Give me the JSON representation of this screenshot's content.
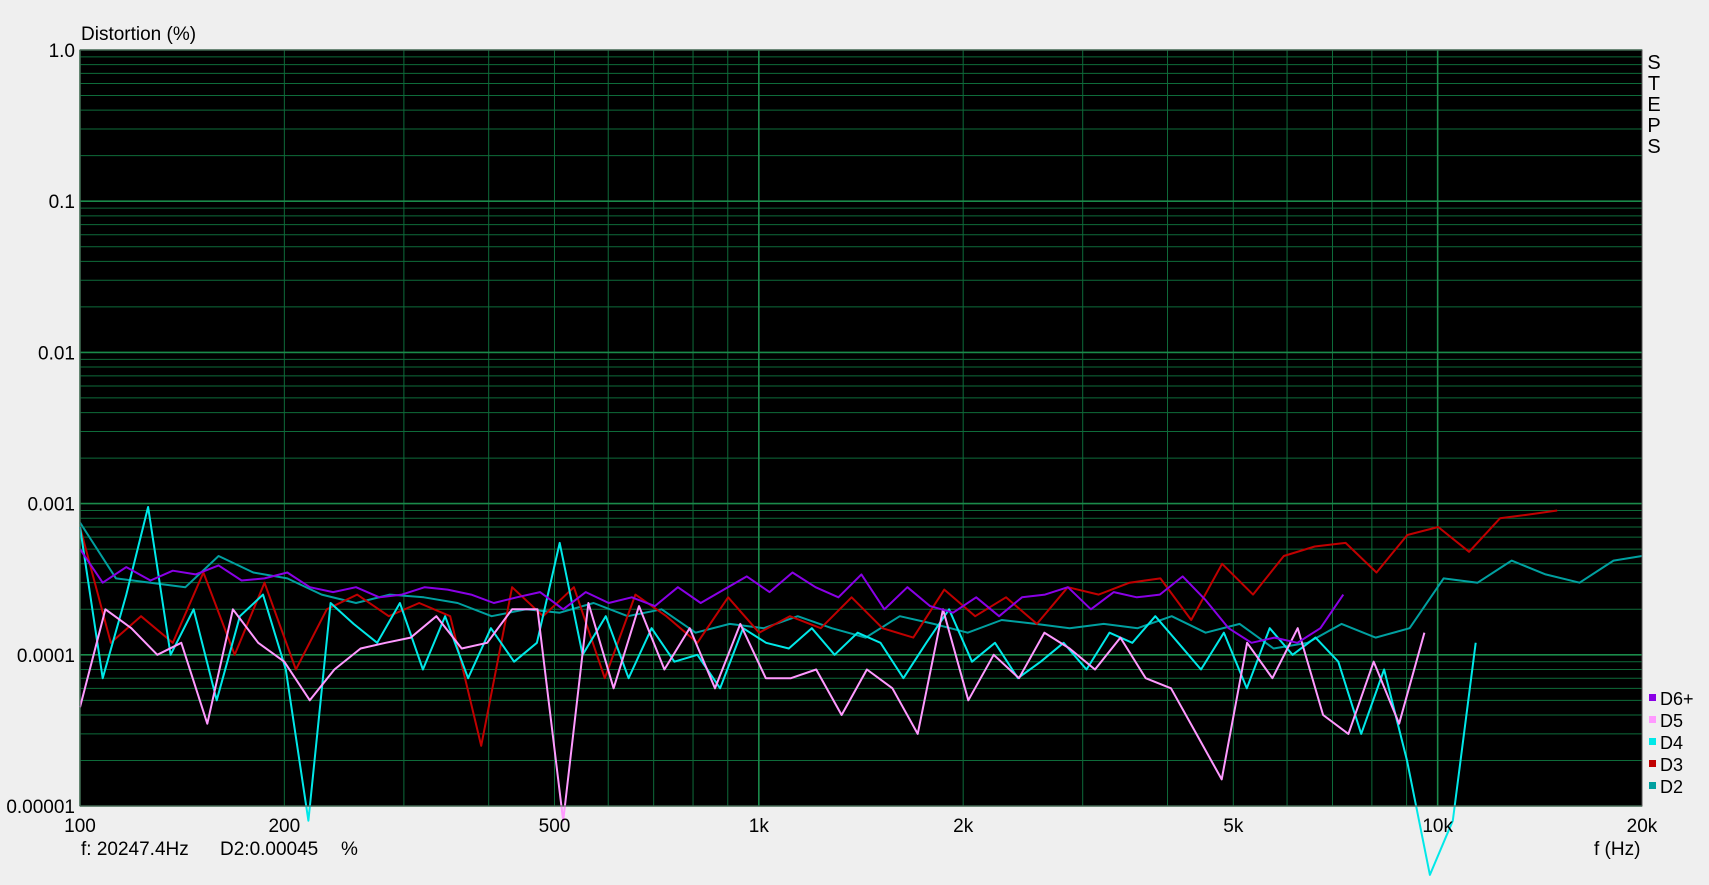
{
  "chart_data": {
    "type": "line",
    "ylabel": "Distortion (%)",
    "xlabel": "f (Hz)",
    "x_scale": "log",
    "y_scale": "log",
    "xlim": [
      100,
      20000
    ],
    "ylim": [
      1e-05,
      1.0
    ],
    "grid": true,
    "background": "#000000",
    "grid_color": "#0e6b3a",
    "legend_position": "bottom-right",
    "x_ticks": [
      {
        "value": 100,
        "label": "100"
      },
      {
        "value": 200,
        "label": "200"
      },
      {
        "value": 500,
        "label": "500"
      },
      {
        "value": 1000,
        "label": "1k"
      },
      {
        "value": 2000,
        "label": "2k"
      },
      {
        "value": 5000,
        "label": "5k"
      },
      {
        "value": 10000,
        "label": "10k"
      },
      {
        "value": 20000,
        "label": "20k"
      }
    ],
    "y_ticks": [
      {
        "value": 1.0,
        "label": "1.0"
      },
      {
        "value": 0.1,
        "label": "0.1"
      },
      {
        "value": 0.01,
        "label": "0.01"
      },
      {
        "value": 0.001,
        "label": "0.001"
      },
      {
        "value": 0.0001,
        "label": "0.0001"
      },
      {
        "value": 1e-05,
        "label": "0.00001"
      }
    ],
    "side_label": "STEPS",
    "cursor_readout": {
      "freq": "f:  20247.4Hz",
      "value": "D2:0.00045",
      "unit": "%"
    },
    "series": [
      {
        "name": "D2",
        "color": "#00a0a0",
        "x": [
          100,
          113,
          127,
          143,
          160,
          180,
          202,
          227,
          255,
          286,
          321,
          360,
          404,
          454,
          509,
          571,
          641,
          719,
          807,
          906,
          1017,
          1141,
          1281,
          1437,
          1613,
          1810,
          2031,
          2279,
          2558,
          2870,
          3221,
          3615,
          4057,
          4552,
          5109,
          5733,
          6434,
          7220,
          8103,
          9093,
          10204,
          11451,
          12850,
          14420,
          16183,
          18160,
          20000
        ],
        "y": [
          0.00075,
          0.00032,
          0.0003,
          0.00028,
          0.00045,
          0.00035,
          0.00032,
          0.00025,
          0.00022,
          0.00025,
          0.00024,
          0.00022,
          0.00018,
          0.0002,
          0.00019,
          0.00022,
          0.00018,
          0.0002,
          0.00014,
          0.00016,
          0.00015,
          0.00018,
          0.00015,
          0.00013,
          0.00018,
          0.00016,
          0.00014,
          0.00017,
          0.00016,
          0.00015,
          0.00016,
          0.00015,
          0.00018,
          0.00014,
          0.00016,
          0.00011,
          0.00012,
          0.00016,
          0.00013,
          0.00015,
          0.00032,
          0.0003,
          0.00042,
          0.00034,
          0.0003,
          0.00042,
          0.00045
        ]
      },
      {
        "name": "D3",
        "color": "#c00000",
        "x": [
          100,
          111,
          123,
          137,
          152,
          169,
          187,
          208,
          231,
          256,
          285,
          316,
          351,
          390,
          433,
          481,
          534,
          593,
          658,
          731,
          812,
          901,
          1001,
          1111,
          1234,
          1370,
          1521,
          1689,
          1876,
          2083,
          2313,
          2568,
          2852,
          3167,
          3516,
          3904,
          4335,
          4814,
          5345,
          5935,
          6590,
          7318,
          8126,
          9023,
          10019,
          11125,
          12353,
          13717,
          15000
        ],
        "y": [
          0.0007,
          0.00012,
          0.00018,
          0.00012,
          0.00035,
          0.0001,
          0.0003,
          8e-05,
          0.0002,
          0.00025,
          0.00018,
          0.00022,
          0.00018,
          2.5e-05,
          0.00028,
          0.00018,
          0.00028,
          7e-05,
          0.00025,
          0.00018,
          0.00012,
          0.00024,
          0.00014,
          0.00018,
          0.00015,
          0.00024,
          0.00015,
          0.00013,
          0.00027,
          0.00018,
          0.00024,
          0.00016,
          0.00028,
          0.00025,
          0.0003,
          0.00032,
          0.00017,
          0.0004,
          0.00025,
          0.00045,
          0.00052,
          0.00055,
          0.00035,
          0.00062,
          0.0007,
          0.00048,
          0.0008,
          0.00085,
          0.0009
        ]
      },
      {
        "name": "D4",
        "color": "#00e8e8",
        "x": [
          100,
          108,
          117,
          126,
          136,
          147,
          159,
          172,
          186,
          201,
          217,
          234,
          253,
          274,
          296,
          320,
          345,
          373,
          403,
          436,
          471,
          509,
          550,
          595,
          643,
          695,
          751,
          812,
          877,
          948,
          1025,
          1107,
          1197,
          1293,
          1398,
          1511,
          1633,
          1765,
          1907,
          2061,
          2228,
          2408,
          2602,
          2812,
          3039,
          3285,
          3550,
          3837,
          4147,
          4481,
          4843,
          5234,
          5657,
          6114,
          6607,
          7140,
          7717,
          8340,
          9013,
          9740,
          10526,
          11376
        ],
        "y": [
          0.0007,
          7e-05,
          0.00025,
          0.00095,
          0.0001,
          0.0002,
          5e-05,
          0.00018,
          0.00025,
          8e-05,
          8e-06,
          0.00022,
          0.00016,
          0.00012,
          0.00022,
          8e-05,
          0.00018,
          7e-05,
          0.00015,
          9e-05,
          0.00012,
          0.00055,
          0.0001,
          0.00018,
          7e-05,
          0.00015,
          9e-05,
          0.0001,
          6e-05,
          0.00015,
          0.00012,
          0.00011,
          0.00015,
          0.0001,
          0.00014,
          0.00012,
          7e-05,
          0.00012,
          0.0002,
          9e-05,
          0.00012,
          7e-05,
          9e-05,
          0.00012,
          8e-05,
          0.00014,
          0.00012,
          0.00018,
          0.00012,
          8e-05,
          0.00014,
          6e-05,
          0.00015,
          0.0001,
          0.00013,
          9e-05,
          3e-05,
          8e-05,
          2e-05,
          3.5e-06,
          8e-06,
          0.00012
        ]
      },
      {
        "name": "D5",
        "color": "#ff99ff",
        "x": [
          100,
          109,
          119,
          130,
          141,
          154,
          168,
          183,
          200,
          218,
          237,
          259,
          282,
          307,
          335,
          365,
          398,
          433,
          472,
          515,
          561,
          611,
          666,
          726,
          791,
          862,
          939,
          1024,
          1115,
          1215,
          1324,
          1443,
          1573,
          1714,
          1868,
          2035,
          2218,
          2417,
          2634,
          2870,
          3128,
          3409,
          3715,
          4048,
          4411,
          4807,
          5239,
          5709,
          6221,
          6780,
          7388,
          8051,
          8773,
          9561
        ],
        "y": [
          4.5e-05,
          0.0002,
          0.00015,
          0.0001,
          0.00012,
          3.5e-05,
          0.0002,
          0.00012,
          9e-05,
          5e-05,
          8e-05,
          0.00011,
          0.00012,
          0.00013,
          0.00018,
          0.00011,
          0.00012,
          0.0002,
          0.0002,
          8e-06,
          0.00022,
          6e-05,
          0.00021,
          8e-05,
          0.00015,
          6e-05,
          0.00016,
          7e-05,
          7e-05,
          8e-05,
          4e-05,
          8e-05,
          6e-05,
          3e-05,
          0.0002,
          5e-05,
          0.0001,
          7e-05,
          0.00014,
          0.00011,
          8e-05,
          0.00013,
          7e-05,
          6e-05,
          3e-05,
          1.5e-05,
          0.00012,
          7e-05,
          0.00015,
          4e-05,
          3e-05,
          9e-05,
          3.5e-05,
          0.00014
        ]
      },
      {
        "name": "D6+",
        "color": "#8a00e6",
        "x": [
          100,
          108,
          117,
          127,
          137,
          148,
          160,
          173,
          187,
          202,
          218,
          236,
          255,
          276,
          298,
          322,
          348,
          377,
          407,
          440,
          476,
          515,
          556,
          601,
          650,
          703,
          760,
          821,
          888,
          960,
          1037,
          1121,
          1212,
          1310,
          1416,
          1531,
          1655,
          1788,
          1933,
          2090,
          2259,
          2442,
          2640,
          2853,
          3084,
          3334,
          3604,
          3896,
          4211,
          4552,
          4920,
          5319,
          5749,
          6215,
          6718,
          7262
        ],
        "y": [
          0.0005,
          0.0003,
          0.00038,
          0.00031,
          0.00036,
          0.00034,
          0.00039,
          0.00031,
          0.00032,
          0.00035,
          0.00028,
          0.00026,
          0.00028,
          0.00024,
          0.00025,
          0.00028,
          0.00027,
          0.00025,
          0.00022,
          0.00024,
          0.00026,
          0.0002,
          0.00026,
          0.00022,
          0.00024,
          0.00021,
          0.00028,
          0.00022,
          0.00027,
          0.00033,
          0.00026,
          0.00035,
          0.00028,
          0.00024,
          0.00034,
          0.0002,
          0.00028,
          0.00021,
          0.00019,
          0.00024,
          0.00018,
          0.00024,
          0.00025,
          0.00028,
          0.0002,
          0.00026,
          0.00024,
          0.00025,
          0.00033,
          0.00023,
          0.00015,
          0.00012,
          0.00013,
          0.00012,
          0.00015,
          0.00025
        ]
      }
    ]
  }
}
